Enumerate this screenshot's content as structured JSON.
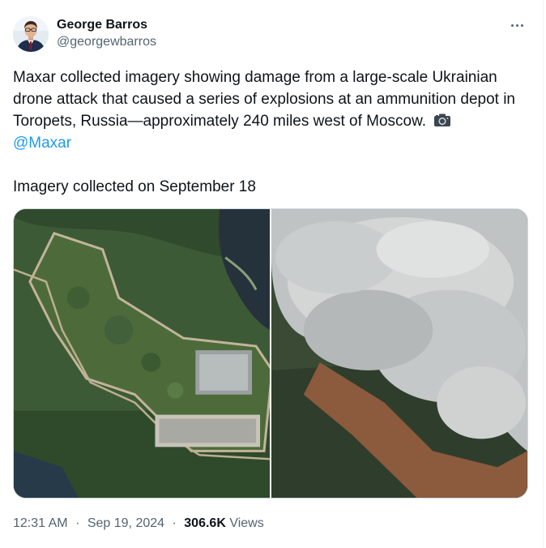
{
  "author": {
    "display_name": "George Barros",
    "handle": "@georgewbarros"
  },
  "tweet": {
    "text": "Maxar collected imagery showing damage from a large-scale Ukrainian drone attack that caused a series of explosions at an ammunition depot in Toropets, Russia—approximately 240 miles west of Moscow.",
    "camera_icon": "camera-icon",
    "mention": "@Maxar",
    "subtext": "Imagery collected on September 18"
  },
  "meta": {
    "time": "12:31 AM",
    "date": "Sep 19, 2024",
    "separator": "·",
    "views_count": "306.6K",
    "views_label": "Views"
  },
  "colors": {
    "link": "#1d9bf0",
    "secondary_text": "#536471",
    "primary_text": "#0f1419"
  }
}
